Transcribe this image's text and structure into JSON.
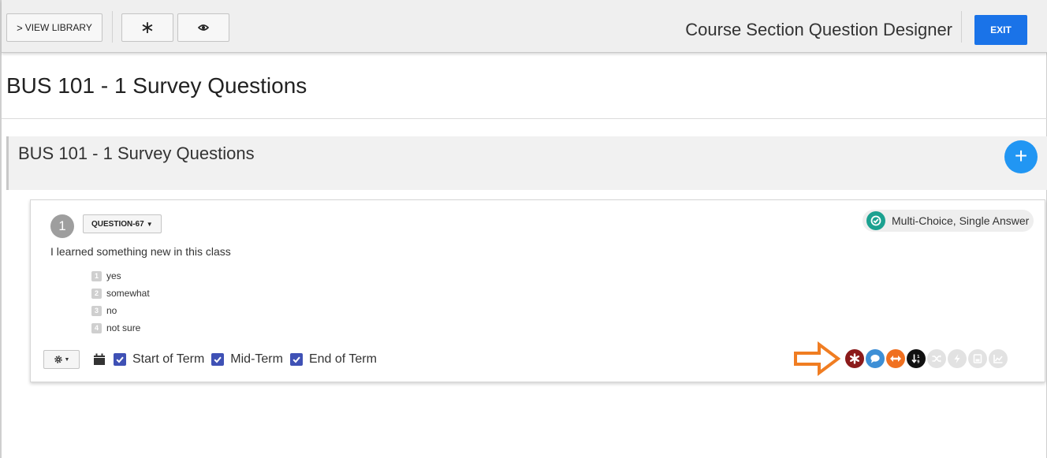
{
  "toolbar": {
    "view_library_label": "VIEW LIBRARY",
    "view_library_icon": "chevron-right-icon",
    "star_button_icon": "asterisk-icon",
    "preview_button_icon": "eye-icon",
    "designer_title": "Course Section Question Designer",
    "exit_label": "EXIT"
  },
  "page": {
    "title": "BUS 101 - 1 Survey Questions"
  },
  "section": {
    "title": "BUS 101 - 1 Survey Questions",
    "add_icon": "plus-icon"
  },
  "question": {
    "number": "1",
    "id_label": "QUESTION-67",
    "type_label": "Multi-Choice, Single Answer",
    "text": "I learned something new in this class",
    "answers": [
      {
        "num": "1",
        "label": "yes"
      },
      {
        "num": "2",
        "label": "somewhat"
      },
      {
        "num": "3",
        "label": "no"
      },
      {
        "num": "4",
        "label": "not sure"
      }
    ],
    "terms": [
      {
        "label": "Start of Term",
        "checked": true
      },
      {
        "label": "Mid-Term",
        "checked": true
      },
      {
        "label": "End of Term",
        "checked": true
      }
    ],
    "option_icons": [
      {
        "name": "required-icon",
        "color": "#8b1a1a",
        "active": true
      },
      {
        "name": "comment-icon",
        "color": "#3d8fd6",
        "active": true
      },
      {
        "name": "horizontal-layout-icon",
        "color": "#f07020",
        "active": true
      },
      {
        "name": "sort-order-icon",
        "color": "#111111",
        "active": true
      },
      {
        "name": "shuffle-icon",
        "color": "#e2e2e2",
        "active": false
      },
      {
        "name": "lightning-icon",
        "color": "#e2e2e2",
        "active": false
      },
      {
        "name": "save-icon",
        "color": "#e2e2e2",
        "active": false
      },
      {
        "name": "chart-icon",
        "color": "#e2e2e2",
        "active": false
      }
    ]
  },
  "colors": {
    "accent": "#1a73e8",
    "add_button": "#2196f3",
    "checkbox": "#3f51b5",
    "type_badge_check": "#1ba190",
    "arrow": "#f07d22"
  }
}
